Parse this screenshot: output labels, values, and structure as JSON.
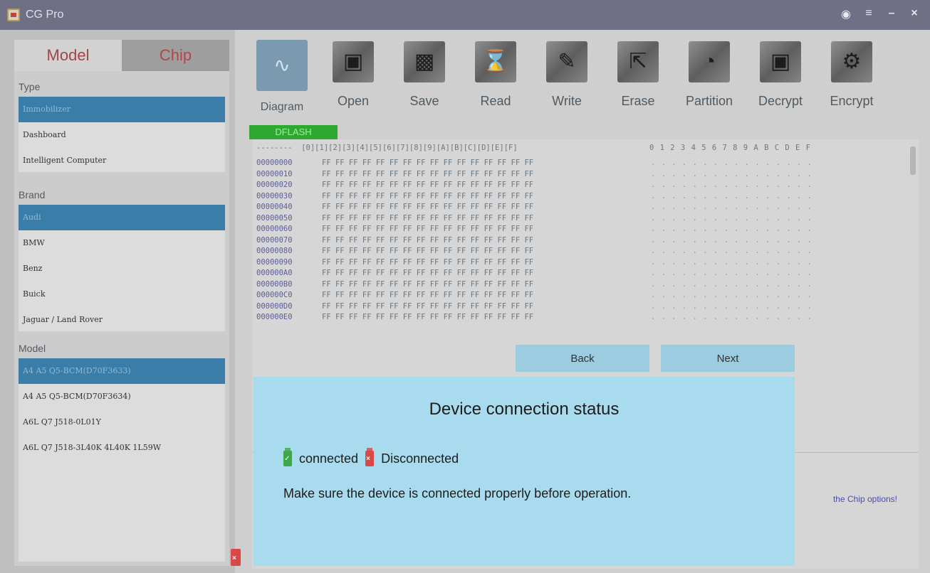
{
  "window": {
    "title": "CG Pro",
    "controls": [
      "user-icon",
      "menu-icon",
      "minimize-icon",
      "close-icon"
    ]
  },
  "left": {
    "tabs": {
      "model": "Model",
      "chip": "Chip"
    },
    "type_label": "Type",
    "types": [
      "Immobilizer",
      "Dashboard",
      "Intelligent Computer"
    ],
    "brand_label": "Brand",
    "brands": [
      "Audi",
      "BMW",
      "Benz",
      "Buick",
      "Jaguar / Land Rover"
    ],
    "model_label": "Model",
    "models": [
      "A4 A5 Q5-BCM(D70F3633)",
      "A4 A5 Q5-BCM(D70F3634)",
      "A6L Q7 J518-0L01Y",
      "A6L Q7 J518-3L40K 4L40K 1L59W"
    ]
  },
  "toolbar": {
    "diagram": "Diagram",
    "open": "Open",
    "save": "Save",
    "read": "Read",
    "write": "Write",
    "erase": "Erase",
    "partition": "Partition",
    "decrypt": "Decrypt",
    "encrypt": "Encrypt"
  },
  "memory_tab": "DFLASH",
  "hex": {
    "header": "--------  [0][1][2][3][4][5][6][7][8][9][A][B][C][D][E][F]",
    "ascii_header": "0 1 2 3 4 5 6 7 8 9 A B C D E F",
    "addresses": [
      "00000000",
      "00000010",
      "00000020",
      "00000030",
      "00000040",
      "00000050",
      "00000060",
      "00000070",
      "00000080",
      "00000090",
      "000000A0",
      "000000B0",
      "000000C0",
      "000000D0",
      "000000E0"
    ],
    "bytes": "FF FF FF FF FF FF FF FF FF FF FF FF FF FF FF FF",
    "ascii": ". . . . . . . . . . . . . . . ."
  },
  "hint": "the Chip options!",
  "dialog": {
    "back": "Back",
    "next": "Next",
    "title": "Device connection status",
    "connected": "connected",
    "disconnected": "Disconnected",
    "message": "Make sure the device is connected properly before operation."
  },
  "colors": {
    "accent": "#3a7da8",
    "dialog_bg": "#a8dbee",
    "dflash": "#2ea82e",
    "connected": "#3da84a",
    "disconnected": "#d94747"
  }
}
